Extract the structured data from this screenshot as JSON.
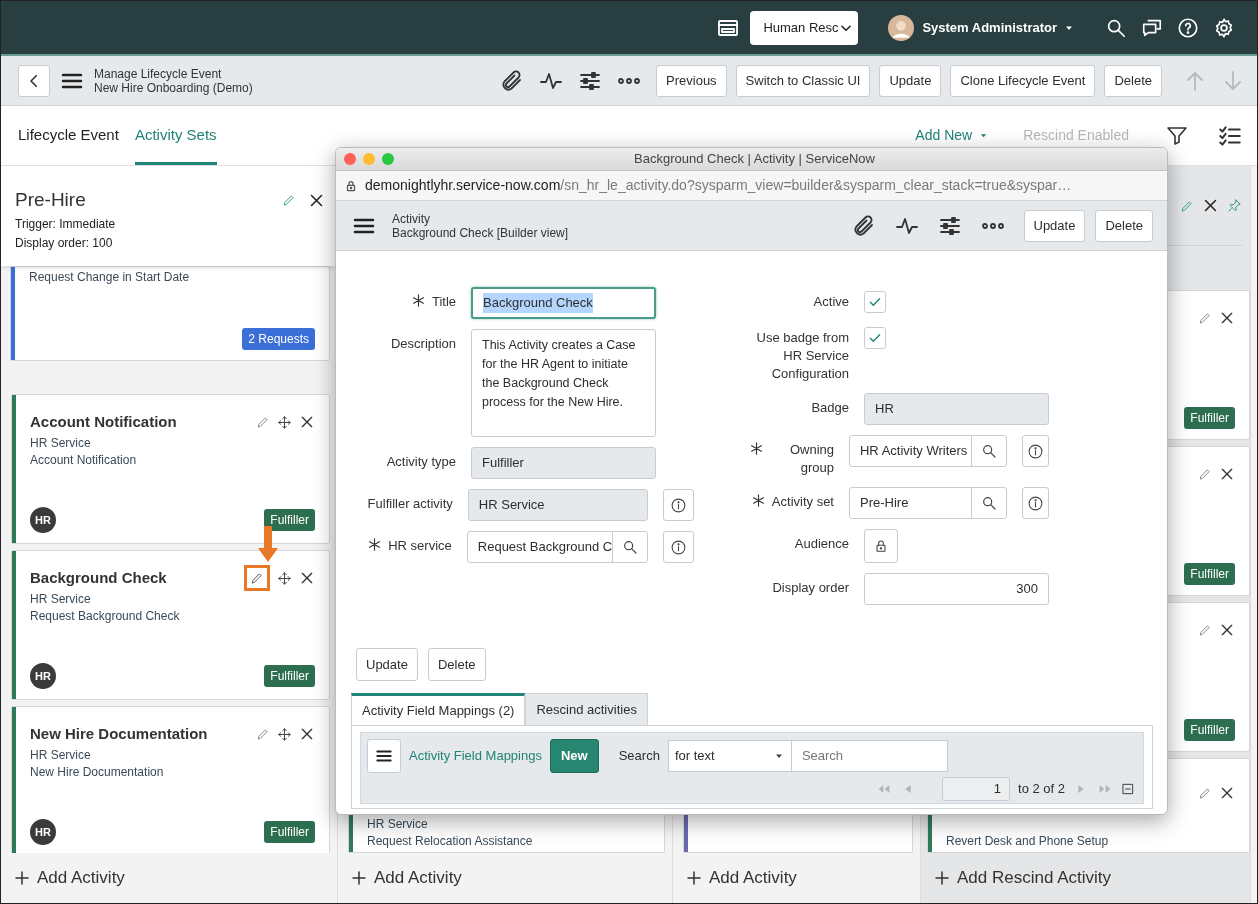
{
  "top_bar": {
    "app_select": "Human Resc",
    "user": "System Administrator"
  },
  "form_header": {
    "title": "Manage Lifecycle Event",
    "subtitle": "New Hire Onboarding (Demo)",
    "buttons": [
      "Previous",
      "Switch to Classic UI",
      "Update",
      "Clone Lifecycle Event",
      "Delete"
    ]
  },
  "tabs": [
    {
      "label": "Lifecycle Event",
      "selected": false
    },
    {
      "label": "Activity Sets",
      "selected": true
    }
  ],
  "toolbar": {
    "add_new": "Add New",
    "rescind": {
      "label": "Rescind Enabled",
      "disabled": true
    }
  },
  "activity_set": {
    "title": "Pre-Hire",
    "trigger": "Trigger: Immediate",
    "display_order": "Display order: 100"
  },
  "columns": [
    {
      "kind": "set",
      "footer": "Add Activity",
      "cards": [
        {
          "kind": "partial",
          "color": "#3b6fd8",
          "subtitle": "Request Change in Start Date",
          "badge": {
            "label": "2 Requests",
            "kind": "requests"
          }
        },
        {
          "kind": "activity",
          "color": "#2e7a59",
          "title": "Account Notification",
          "service": "HR Service",
          "subtitle": "Account Notification",
          "avatar": "HR",
          "badge": {
            "label": "Fulfiller",
            "kind": "fulfiller"
          },
          "movable": true,
          "highlighted": false
        },
        {
          "kind": "activity",
          "color": "#2e7a59",
          "title": "Background Check",
          "service": "HR Service",
          "subtitle": "Request Background Check",
          "avatar": "HR",
          "badge": {
            "label": "Fulfiller",
            "kind": "fulfiller"
          },
          "movable": true,
          "highlighted": true
        },
        {
          "kind": "activity",
          "color": "#2e7a59",
          "title": "New Hire Documentation",
          "service": "HR Service",
          "subtitle": "New Hire Documentation",
          "avatar": "HR",
          "badge": {
            "label": "Fulfiller",
            "kind": "fulfiller"
          },
          "movable": true,
          "highlighted": false
        }
      ]
    },
    {
      "kind": "set",
      "footer": "Add Activity",
      "cards": [
        {
          "kind": "tail",
          "color": "#2e7a59",
          "service": "HR Service",
          "subtitle": "Request Relocation Assistance"
        }
      ]
    },
    {
      "kind": "set",
      "footer": "Add Activity",
      "cards": [
        {
          "kind": "tail",
          "color": "#6b68b0"
        }
      ]
    },
    {
      "kind": "rescind",
      "footer": "Add Rescind Activity",
      "cards": [
        {
          "kind": "activity",
          "badge": {
            "label": "Fulfiller",
            "kind": "fulfiller"
          },
          "movable": false,
          "highlighted": false
        },
        {
          "kind": "activity",
          "badge": {
            "label": "Fulfiller",
            "kind": "fulfiller"
          },
          "movable": false,
          "highlighted": false
        },
        {
          "kind": "activity",
          "badge": {
            "label": "Fulfiller",
            "kind": "fulfiller"
          },
          "movable": false,
          "highlighted": false
        },
        {
          "kind": "tail",
          "color": "#2e7a59",
          "subtitle": "Revert Desk and Phone Setup",
          "actions": true
        }
      ]
    }
  ],
  "modal": {
    "window_title": "Background Check | Activity | ServiceNow",
    "url_host": "demonightlyhr.service-now.com",
    "url_path": "/sn_hr_le_activity.do?sysparm_view=builder&sysparm_clear_stack=true&syspar…",
    "header": {
      "title": "Activity",
      "subtitle": "Background Check [Builder view]",
      "buttons": [
        "Update",
        "Delete"
      ]
    },
    "left_fields": [
      {
        "kind": "text",
        "label": "Title",
        "required": true,
        "value": "Background Check",
        "focused": true
      },
      {
        "kind": "textarea",
        "label": "Description",
        "value": "This Activity creates a Case for the HR Agent to initiate the Background Check process for the New Hire."
      },
      {
        "kind": "readonly",
        "label": "Activity type",
        "value": "Fulfiller",
        "info": false
      },
      {
        "kind": "readonly",
        "label": "Fulfiller activity",
        "value": "HR Service",
        "info": true
      },
      {
        "kind": "reference",
        "label": "HR service",
        "required": true,
        "value": "Request Background C",
        "info": true
      }
    ],
    "right_fields": [
      {
        "kind": "checkbox",
        "label": "Active",
        "checked": true
      },
      {
        "kind": "checkbox",
        "label": "Use badge from HR Service Configuration",
        "checked": true
      },
      {
        "kind": "readonly",
        "label": "Badge",
        "value": "HR",
        "info": false
      },
      {
        "kind": "reference",
        "label": "Owning group",
        "required": true,
        "value": "HR Activity Writers",
        "info": true
      },
      {
        "kind": "reference",
        "label": "Activity set",
        "required": true,
        "value": "Pre-Hire",
        "info": true
      },
      {
        "kind": "lock",
        "label": "Audience"
      },
      {
        "kind": "number",
        "label": "Display order",
        "value": "300"
      }
    ],
    "buttons": [
      "Update",
      "Delete"
    ],
    "related_tabs": [
      {
        "label": "Activity Field Mappings (2)",
        "selected": true
      },
      {
        "label": "Rescind activities",
        "selected": false
      }
    ],
    "list": {
      "title": "Activity Field Mappings",
      "new_button": "New",
      "search_label": "Search",
      "filter": "for text",
      "search_placeholder": "Search",
      "page": "1",
      "range": "to 2 of 2"
    }
  }
}
